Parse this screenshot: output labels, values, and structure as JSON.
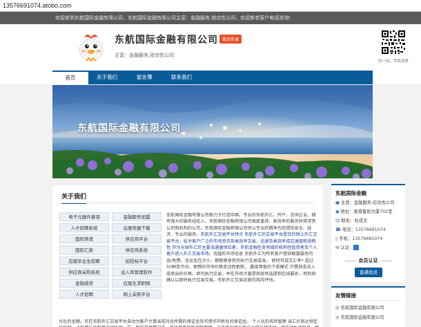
{
  "browser": {
    "url": "13576691074.atobo.com"
  },
  "topbar": {
    "welcome": "欢迎来到东航国际金融有限公司，东航国际金融有限公司主营：金融服务,综合性公司，欢迎新老客户电话咨询!"
  },
  "header": {
    "company_name": "东航国际金融有限公司",
    "badge": "黄页名录",
    "business_label": "主营：",
    "business": "金融服务,综合性公司",
    "qr_caption": "扫一扫，手机浏览"
  },
  "nav": {
    "items": [
      "首页",
      "关于我们",
      "留言薄",
      "联系我们"
    ]
  },
  "banner": {
    "title": "东航国际金融有限公司"
  },
  "about": {
    "title": "关于我们",
    "tags": [
      "电子元器件查询",
      "金融服务加盟",
      "人才招聘系统",
      "云服务器下载",
      "国际快递",
      "供应商平台",
      "国际汇款",
      "供应商系统",
      "应届毕业生招聘",
      "招投标平台",
      "供应商采购系统",
      "出入库管理软件",
      "金融借贷",
      "应届生求职网",
      "人才招聘",
      "网上采购平台"
    ],
    "text_p1": "东航国际金融有限公司致力于打造中国、专业的东航外汇、开户、咨询企业，拥有强大的服务经纪人，东航国际金融有限公司高度重视、高效率的服务获得求赏公司和机构的认可。东航国际金融有限公司将以专业的精神为您提供安全、经济、专业的服务。",
    "text_hl": "东航外汇交易平台特点 东航外汇的交易平台是您的网上外汇交易平台，给予客户广泛的市场资讯及高效率交易，迅速及高效率成交速度和流畅性 作为全球外汇的主要流通量供应者，东航金融在各领域的机构性投资者及个人客户进入外汇交易市场。",
    "text_p2": "优越的市场信息 东航外汇为所有客户提供概要服务内容/免费、无论会在大小、都能够享有的执行交易成本。 即时可成交汇率* 超过50种货币对、更畅的市场价格变动而更新。 嘉接筛查的下单模式 只需双击买入或卖出的价格，即可执行交易，并在市场大量提供现场选提和在线服务，然后按确认以即时执行交易交易。东航外汇交易运营的风险评估。",
    "text_full": "分比的金额。可在东航外汇交易平台自动为客户计算当前持仓所需的保证金及可用作开新仓的保证金。 个人化的风险管理 当汇价到达预定价位时，止损单与获利单自动执行。在一般的市场情况下，可达致有效的风险管理。当市场价格与客户止损价持平时，便自动执行交易，给客户更大的自主权。"
  },
  "sidebar": {
    "company_title": "东航国际金融",
    "rows": [
      {
        "icon": "▣",
        "label": "主营：",
        "value": "金融服务,综合性公司"
      },
      {
        "icon": "◉",
        "label": "地址：",
        "value": "香港鲁斯大厦702室"
      },
      {
        "icon": "☺",
        "label": "联系：",
        "value": "杜成文"
      },
      {
        "icon": "☎",
        "label": "电话：",
        "value": "13576691074"
      },
      {
        "icon": "▯",
        "label": "手机：",
        "value": "13576691074"
      },
      {
        "icon": "✉",
        "label": "认证：",
        "value": ""
      }
    ],
    "member_label": "会员认证",
    "member_button": "普通会员"
  },
  "links": {
    "title": "友情链接",
    "items": [
      "东航国际金融有限公司",
      "东航国际金融有限公司"
    ]
  },
  "colors": {
    "nav_blue": "#0a5b9a",
    "badge_orange": "#e8502a"
  }
}
